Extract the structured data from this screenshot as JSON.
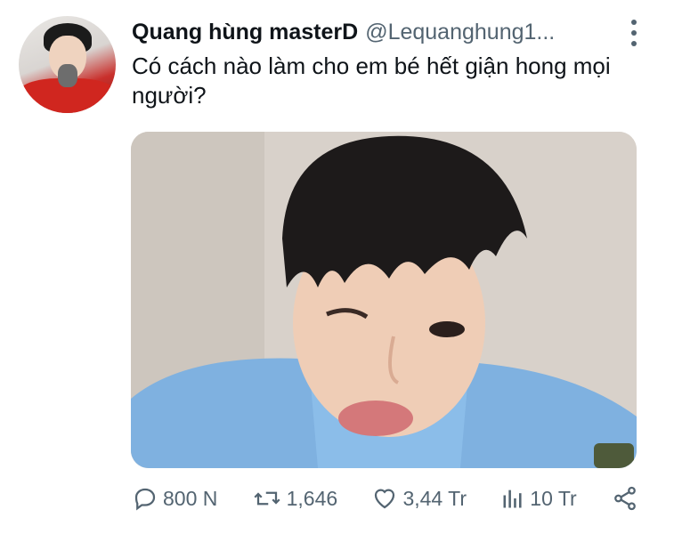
{
  "tweet": {
    "display_name": "Quang hùng masterD",
    "handle": "@Lequanghung1...",
    "text": "Có cách nào làm cho em bé hết giận hong mọi người?",
    "more_icon": "more-vertical-icon"
  },
  "actions": {
    "reply": {
      "icon": "reply-icon",
      "count": "800 N"
    },
    "retweet": {
      "icon": "retweet-icon",
      "count": "1,646"
    },
    "like": {
      "icon": "heart-icon",
      "count": "3,44 Tr"
    },
    "views": {
      "icon": "views-bar-chart-icon",
      "count": "10 Tr"
    },
    "share": {
      "icon": "share-icon"
    }
  },
  "colors": {
    "text_primary": "#0f1419",
    "text_secondary": "#536471"
  }
}
